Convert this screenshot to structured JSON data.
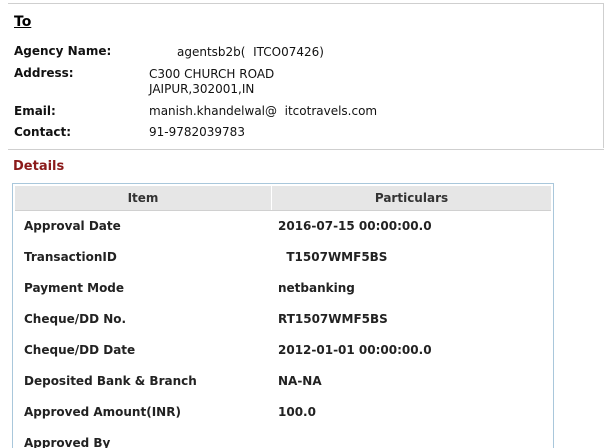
{
  "to": {
    "heading": "To"
  },
  "agency": {
    "label": "Agency Name:",
    "value": "agentsb2b(  ITCO07426)"
  },
  "address": {
    "label": "Address:",
    "line1": "C300 CHURCH ROAD",
    "line2": "JAIPUR,302001,IN"
  },
  "email": {
    "label": "Email:",
    "value": "manish.khandelwal@  itcotravels.com"
  },
  "contact": {
    "label": "Contact:",
    "value": "91-9782039783"
  },
  "details": {
    "heading": "Details",
    "columns": [
      "Item",
      "Particulars"
    ],
    "rows": [
      {
        "item": "Approval Date",
        "particulars": "2016-07-15 00:00:00.0"
      },
      {
        "item": "TransactionID",
        "particulars": "  T1507WMF5BS"
      },
      {
        "item": "Payment Mode",
        "particulars": "netbanking"
      },
      {
        "item": "Cheque/DD No.",
        "particulars": "RT1507WMF5BS"
      },
      {
        "item": "Cheque/DD Date",
        "particulars": "2012-01-01 00:00:00.0"
      },
      {
        "item": "Deposited Bank & Branch",
        "particulars": "NA-NA"
      },
      {
        "item": "Approved Amount(INR)",
        "particulars": "100.0"
      },
      {
        "item": "Approved By",
        "particulars": ""
      }
    ]
  },
  "colors": {
    "details_heading": "#8b1a1a",
    "table_border": "#a9c7db",
    "header_bg": "#e6e6e6"
  }
}
